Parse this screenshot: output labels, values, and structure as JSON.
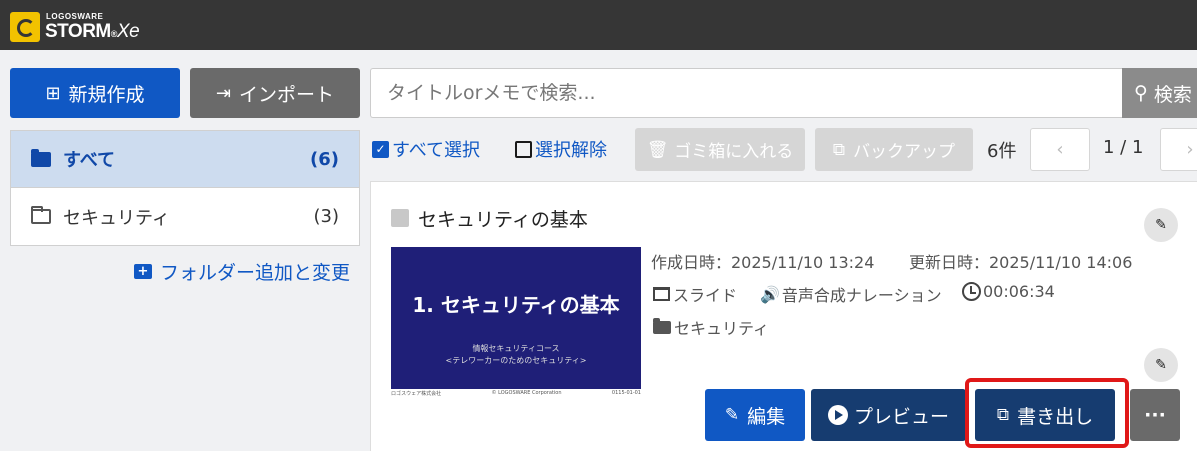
{
  "app": {
    "logo_small": "LOGOSWARE",
    "logo_main": "STORM",
    "logo_reg": "®",
    "logo_xe": "Xe"
  },
  "header": {
    "new_label": "新規作成",
    "import_label": "インポート",
    "search_placeholder": "タイトルorメモで検索...",
    "search_label": "検索"
  },
  "sidebar": {
    "items": [
      {
        "label": "すべて",
        "count": "(6)",
        "active": true
      },
      {
        "label": "セキュリティ",
        "count": "(3)",
        "active": false
      }
    ],
    "add_folder_label": "フォルダー追加と変更"
  },
  "toolbar": {
    "select_all": "すべて選択",
    "deselect": "選択解除",
    "trash": "ゴミ箱に入れる",
    "backup": "バックアップ",
    "count": "6件",
    "page": "1 / 1",
    "prev": "‹",
    "next": "›"
  },
  "card": {
    "title": "セキュリティの基本",
    "created": "作成日時：2025/11/10 13:24",
    "updated": "更新日時：2025/11/10 14:06",
    "type": "スライド",
    "narration": "音声合成ナレーション",
    "duration": "00:06:34",
    "folder": "セキュリティ",
    "thumbnail": {
      "title": "1. セキュリティの基本",
      "line1": "情報セキュリティコース",
      "line2": "<テレワーカーのためのセキュリティ>",
      "foot_left": "ロゴスウェア株式会社",
      "foot_mid": "© LOGOSWARE Corporation",
      "foot_right": "0115-01-01"
    },
    "actions": {
      "edit": "編集",
      "preview": "プレビュー",
      "export": "書き出し",
      "more": "···"
    }
  },
  "colors": {
    "primary": "#1058c4",
    "dark_navy": "#163c70",
    "highlight": "#e01818"
  }
}
